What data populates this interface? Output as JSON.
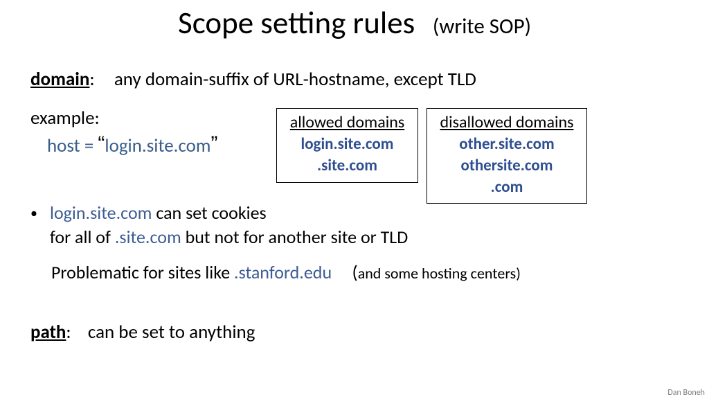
{
  "title": {
    "main": "Scope setting rules",
    "sub": "(write SOP)"
  },
  "domain_line": {
    "label": "domain",
    "colon": ":",
    "text": "any domain-suffix of URL-hostname, except TLD"
  },
  "example": {
    "label": "example:",
    "host_prefix": "host = ",
    "host_value": "login.site.com",
    "lq": "“",
    "rq": "”"
  },
  "allowed": {
    "header": "allowed domains",
    "items": [
      "login.site.com",
      ".site.com"
    ]
  },
  "disallowed": {
    "header": "disallowed domains",
    "items": [
      "other.site.com",
      "othersite.com",
      ".com"
    ]
  },
  "bullet": {
    "dot": "•",
    "part1": "login.site.com",
    "part2": " can set cookies",
    "part3": "for all of ",
    "part4": ".site.com",
    "part5": "   but not for another site  or  TLD"
  },
  "problem": {
    "pre": "Problematic for sites like   ",
    "site": ".stanford.edu",
    "paren": "(",
    "tail": "and some hosting centers)"
  },
  "path": {
    "label": "path",
    "colon": ":",
    "text": "can be set to anything"
  },
  "attribution": "Dan Boneh"
}
